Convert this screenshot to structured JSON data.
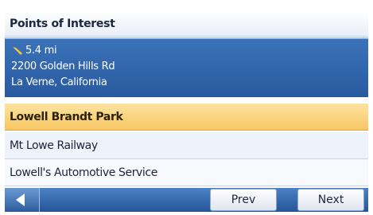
{
  "header": {
    "title": "Points of Interest"
  },
  "current_location": {
    "distance": "5.4 mi",
    "street": "2200 Golden Hills Rd",
    "city": "La Verne, California"
  },
  "list": {
    "items": [
      {
        "label": "Lowell Brandt Park",
        "selected": true
      },
      {
        "label": "Mt Lowe Railway",
        "selected": false
      },
      {
        "label": "Lowell's Automotive Service",
        "selected": false
      }
    ]
  },
  "footer": {
    "back_icon": "left-arrow-icon",
    "prev_label": "Prev",
    "next_label": "Next"
  },
  "colors": {
    "highlight": "#f7c762",
    "header_blue": "#2a5aa0",
    "toolbar_blue": "#255596"
  }
}
